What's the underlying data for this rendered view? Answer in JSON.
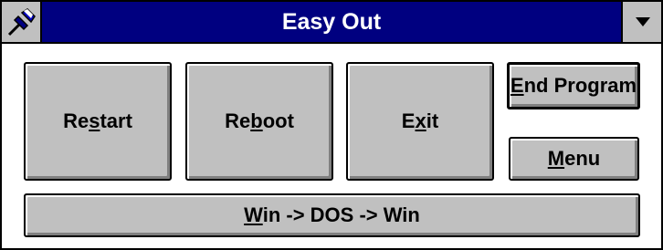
{
  "window": {
    "title": "Easy Out"
  },
  "buttons": {
    "restart": {
      "pre": "Re",
      "key": "s",
      "post": "tart"
    },
    "reboot": {
      "pre": "Re",
      "key": "b",
      "post": "oot"
    },
    "exit": {
      "pre": "E",
      "key": "x",
      "post": "it"
    },
    "end_program": {
      "pre": "",
      "key": "E",
      "post": "nd Program"
    },
    "menu": {
      "pre": "",
      "key": "M",
      "post": "enu"
    },
    "win_dos": {
      "pre": "",
      "key": "W",
      "post": "in -> DOS -> Win"
    }
  },
  "icons": {
    "system_menu": "pushpin-icon",
    "dropdown": "down-arrow-icon"
  },
  "colors": {
    "titlebar": "#000080",
    "button_face": "#c0c0c0"
  }
}
